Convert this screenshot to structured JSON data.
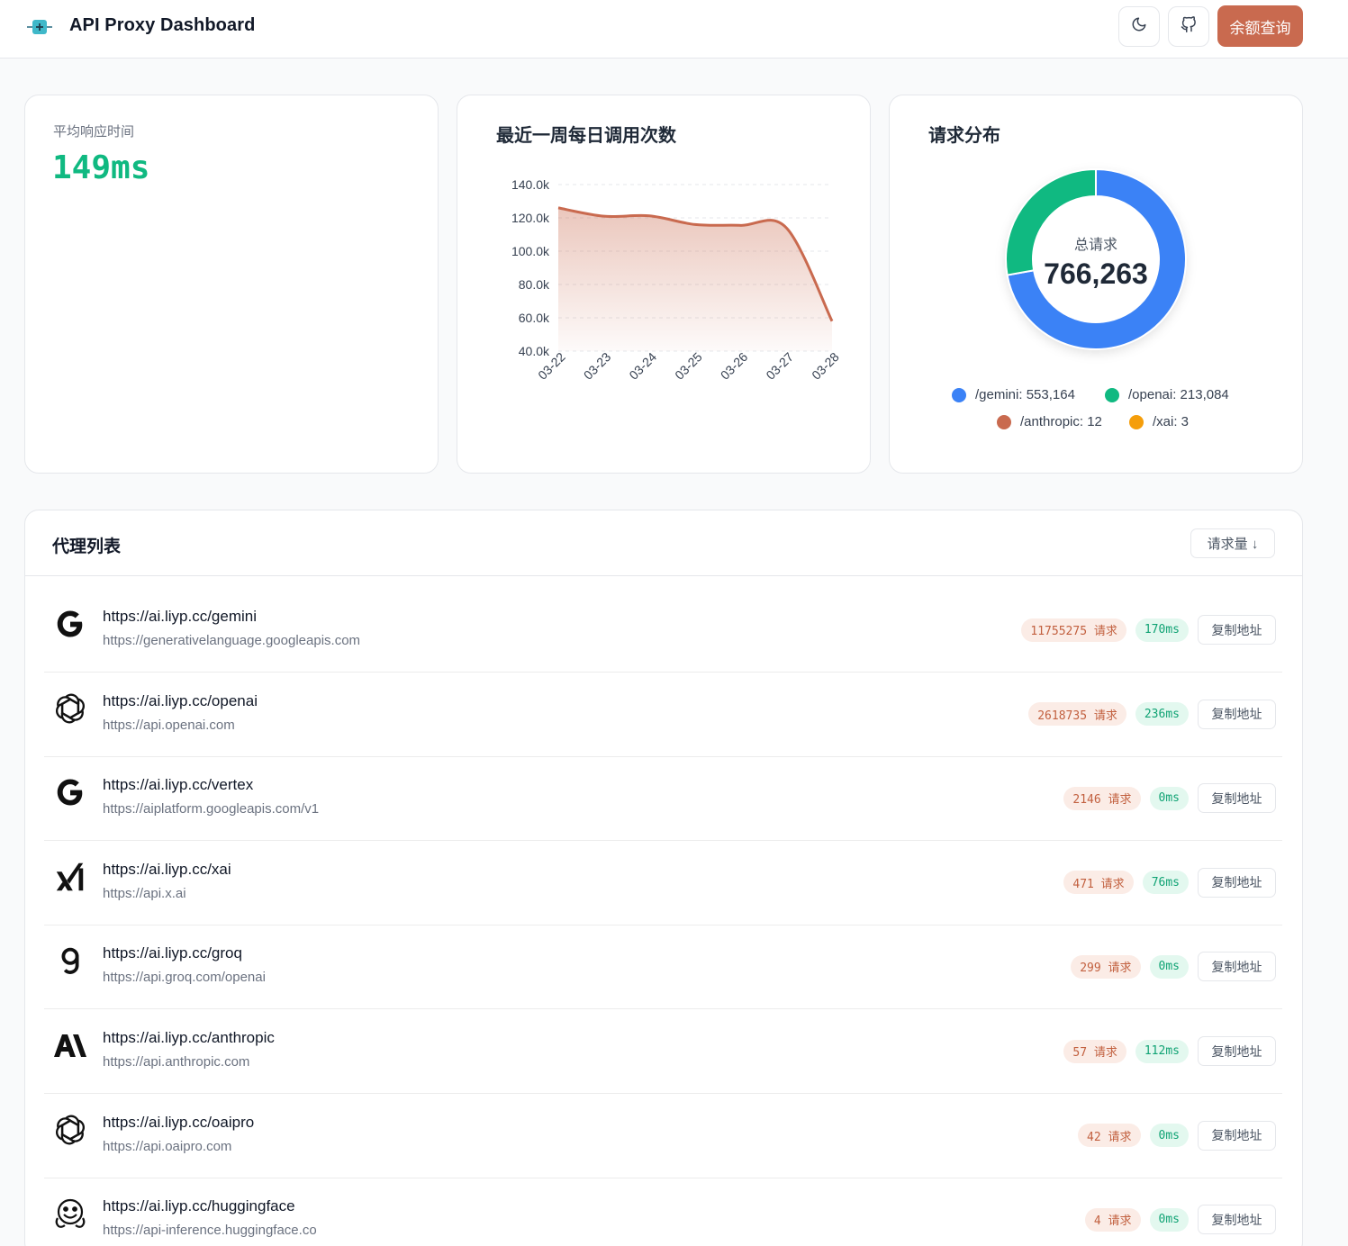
{
  "header": {
    "title": "API Proxy Dashboard",
    "logo_icon": "plug-icon",
    "theme_icon": "moon-icon",
    "github_icon": "github-icon",
    "quota_label": "余额查询",
    "accent": "#c96a4f"
  },
  "stats": {
    "avg_label": "平均响应时间",
    "avg_value": "149ms"
  },
  "line_card": {
    "title": "最近一周每日调用次数"
  },
  "pie_card": {
    "title": "请求分布",
    "center_label": "总请求",
    "center_value": "766,263"
  },
  "chart_data": [
    {
      "type": "area",
      "x": [
        "03-22",
        "03-23",
        "03-24",
        "03-25",
        "03-26",
        "03-27",
        "03-28"
      ],
      "values": [
        126000,
        121000,
        121200,
        116000,
        115500,
        114000,
        58000
      ],
      "ylim": [
        40000,
        140000
      ],
      "yticks": [
        "40.0k",
        "60.0k",
        "80.0k",
        "100.0k",
        "120.0k",
        "140.0k"
      ],
      "color": "#c96a4f",
      "grid": true
    },
    {
      "type": "pie",
      "donut": true,
      "slices": [
        {
          "label": "/gemini: 553,164",
          "name": "/gemini",
          "value": 553164,
          "color": "#3b82f6"
        },
        {
          "label": "/openai: 213,084",
          "name": "/openai",
          "value": 213084,
          "color": "#10b981"
        },
        {
          "label": "/anthropic: 12",
          "name": "/anthropic",
          "value": 12,
          "color": "#c96a4f"
        },
        {
          "label": "/xai: 3",
          "name": "/xai",
          "value": 3,
          "color": "#f59e0b"
        }
      ],
      "legend": "bottom"
    }
  ],
  "list": {
    "title": "代理列表",
    "sort_label": "请求量 ↓",
    "copy_label": "复制地址",
    "items": [
      {
        "icon": "google-icon",
        "proxy": "https://ai.liyp.cc/gemini",
        "target": "https://generativelanguage.googleapis.com",
        "requests": "11755275 请求",
        "latency": "170ms"
      },
      {
        "icon": "openai-icon",
        "proxy": "https://ai.liyp.cc/openai",
        "target": "https://api.openai.com",
        "requests": "2618735 请求",
        "latency": "236ms"
      },
      {
        "icon": "google-icon",
        "proxy": "https://ai.liyp.cc/vertex",
        "target": "https://aiplatform.googleapis.com/v1",
        "requests": "2146 请求",
        "latency": "0ms"
      },
      {
        "icon": "xai-icon",
        "proxy": "https://ai.liyp.cc/xai",
        "target": "https://api.x.ai",
        "requests": "471 请求",
        "latency": "76ms"
      },
      {
        "icon": "groq-icon",
        "proxy": "https://ai.liyp.cc/groq",
        "target": "https://api.groq.com/openai",
        "requests": "299 请求",
        "latency": "0ms"
      },
      {
        "icon": "anthropic-icon",
        "proxy": "https://ai.liyp.cc/anthropic",
        "target": "https://api.anthropic.com",
        "requests": "57 请求",
        "latency": "112ms"
      },
      {
        "icon": "openai-icon",
        "proxy": "https://ai.liyp.cc/oaipro",
        "target": "https://api.oaipro.com",
        "requests": "42 请求",
        "latency": "0ms"
      },
      {
        "icon": "huggingface-icon",
        "proxy": "https://ai.liyp.cc/huggingface",
        "target": "https://api-inference.huggingface.co",
        "requests": "4 请求",
        "latency": "0ms"
      }
    ]
  }
}
